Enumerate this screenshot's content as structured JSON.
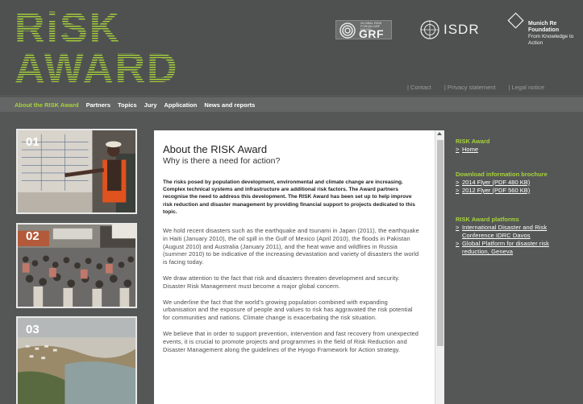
{
  "brand": {
    "logo_line1": "RiSK",
    "logo_line2": "AWARD",
    "accent": "#a7d33a"
  },
  "partners": {
    "grf_small": "GLOBAL RISK FORUM GRF DAVOS",
    "grf": "GRF",
    "isdr": "ISDR",
    "munich_title": "Munich Re Foundation",
    "munich_sub": "From Knowledge to Action"
  },
  "top_links": [
    "| Contact",
    "| Privacy statement",
    "| Legal notice"
  ],
  "nav": [
    {
      "label": "About the RISK Award",
      "active": true
    },
    {
      "label": "Partners",
      "active": false
    },
    {
      "label": "Topics",
      "active": false
    },
    {
      "label": "Jury",
      "active": false
    },
    {
      "label": "Application",
      "active": false
    },
    {
      "label": "News and reports",
      "active": false
    }
  ],
  "thumbs": [
    "01",
    "02",
    "03"
  ],
  "content": {
    "title": "About the RISK Award",
    "subtitle": "Why is there a need for action?",
    "intro": "The risks posed by population development, environmental and climate change are increasing. Complex technical systems and infrastructure are additional risk factors. The Award partners recognise the need to address this development. The RISK Award has been set up to help improve risk reduction and disaster management by providing financial support to projects dedicated to this topic.",
    "paragraphs": [
      "We hold recent disasters such as the earthquake and tsunami in Japan (2011), the earthquake in Haiti (January 2010), the oil spill in the Gulf of Mexico (April 2010), the floods in Pakistan (August 2010) and Australia (January 2011), and the heat wave and wildfires in Russia (summer 2010) to be indicative of the increasing devastation and variety of disasters the world is facing today.",
      "We draw attention to the fact that risk and disasters threaten development and security. Disaster Risk Management must become a major global concern.",
      "We underline the fact that the world's growing population combined with expanding urbanisation and the exposure of people and values to risk has aggravated the risk potential for communities and nations. Climate change is exacerbating the risk situation.",
      "We believe that in order to support prevention, intervention and fast recovery from unexpected events, it is crucial to promote projects and programmes in the field of Risk Reduction and Disaster Management along the guidelines of the Hyogo Framework for Action strategy."
    ]
  },
  "sidebar": {
    "s1_title": "RISK Award",
    "s1_links": [
      "Home"
    ],
    "s2_title": "Download information brochure",
    "s2_links": [
      "2014 Flyer (PDF 480 KB)",
      "2012 Flyer (PDF 560 KB)"
    ],
    "s3_title": "RISK Award platforms",
    "s3_links": [
      "International Disaster and Risk Conference IDRC Davos",
      "Global Platform for disaster risk reduction, Geneva"
    ],
    "arrow": ">"
  }
}
